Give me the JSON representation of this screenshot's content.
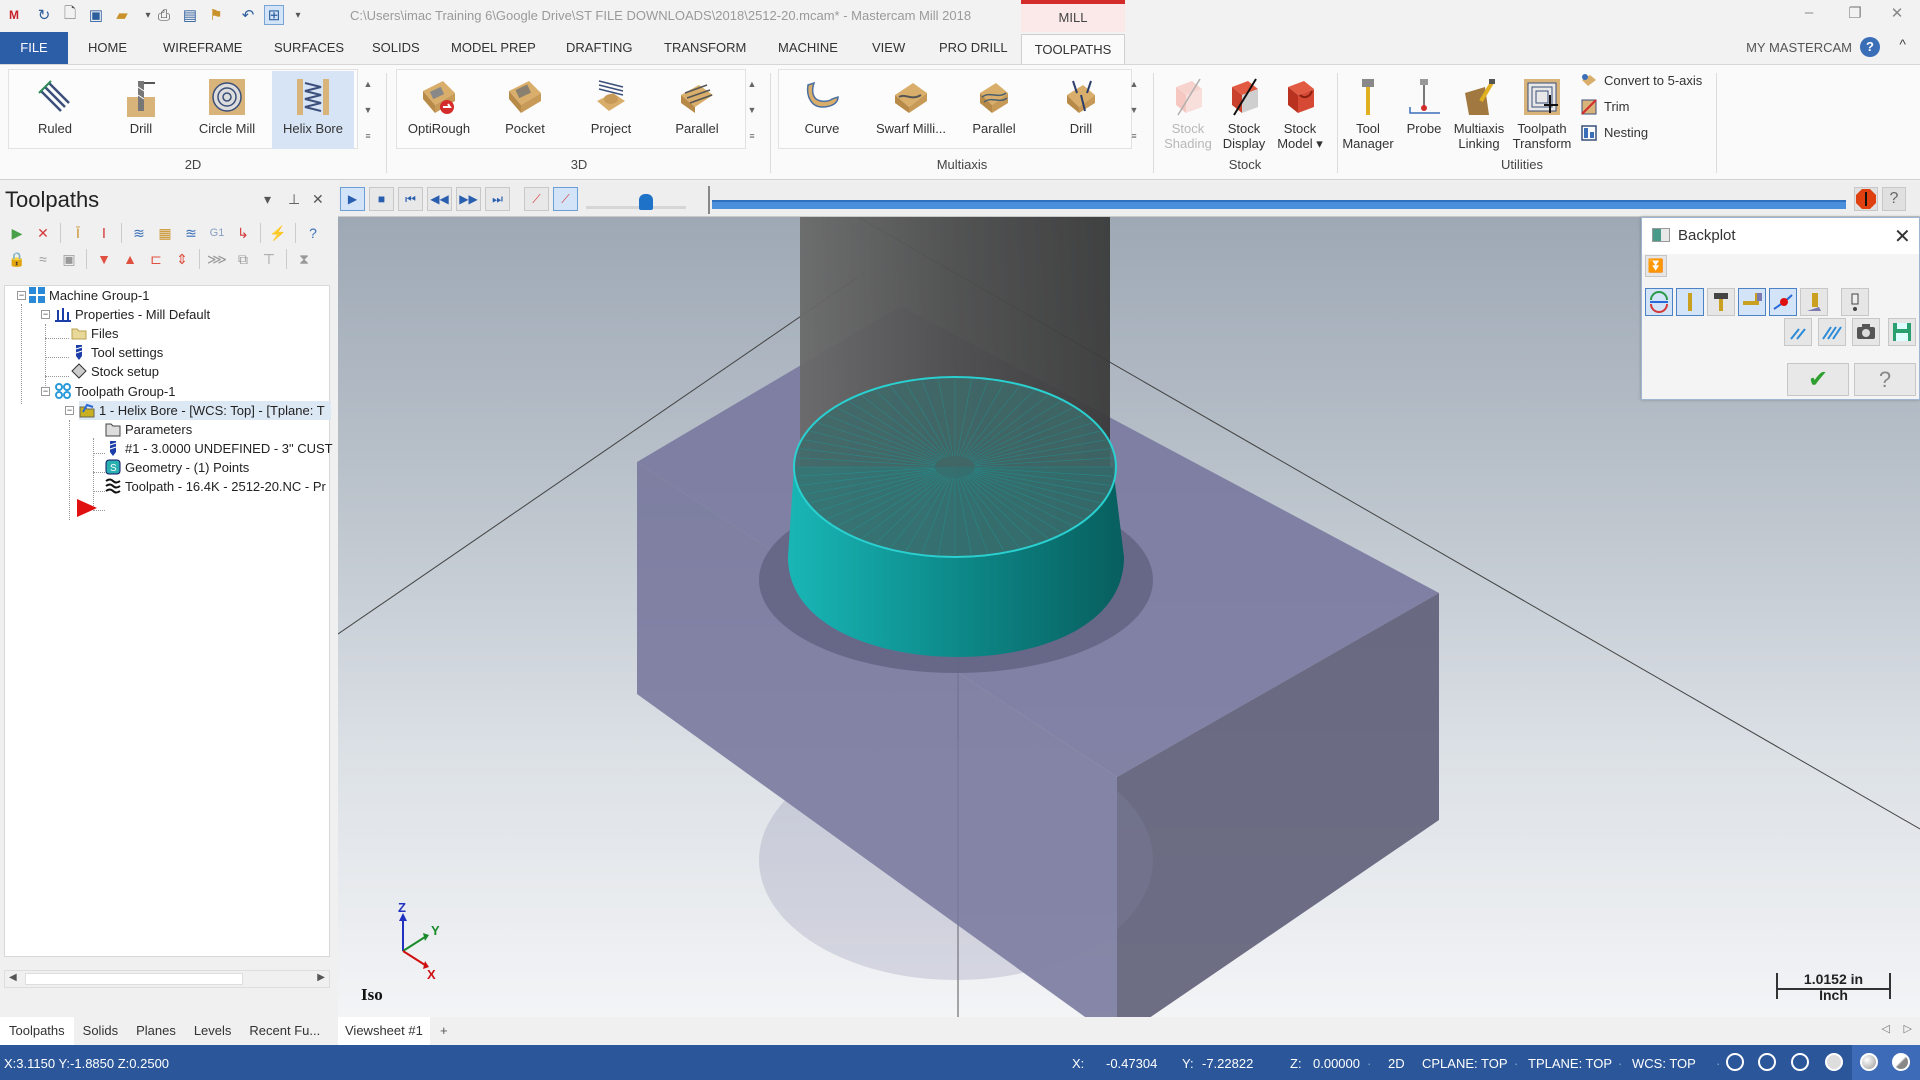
{
  "titlebar": {
    "title": "C:\\Users\\imac Training 6\\Google Drive\\ST FILE DOWNLOADS\\2018\\2512-20.mcam* - Mastercam Mill 2018",
    "context_tab": "MILL",
    "quick_access": [
      "app-logo-icon",
      "redo-icon",
      "new-file-icon",
      "save-icon",
      "open-icon",
      "print-icon",
      "save-as-icon",
      "flag-icon",
      "undo-icon",
      "view-toggle-icon",
      "customize-dropdown-icon"
    ],
    "window_controls": {
      "minimize": "–",
      "restore": "❐",
      "close": "✕"
    }
  },
  "tabs": [
    "FILE",
    "HOME",
    "WIREFRAME",
    "SURFACES",
    "SOLIDS",
    "MODEL PREP",
    "DRAFTING",
    "TRANSFORM",
    "MACHINE",
    "VIEW",
    "PRO DRILL",
    "TOOLPATHS"
  ],
  "active_tab": "TOOLPATHS",
  "account": {
    "label": "MY MASTERCAM",
    "help": "?",
    "collapse": "^"
  },
  "ribbon": {
    "groups": [
      {
        "name": "2D",
        "buttons": [
          "Ruled",
          "Drill",
          "Circle Mill",
          "Helix Bore"
        ],
        "selected": "Helix Bore"
      },
      {
        "name": "3D",
        "buttons": [
          "OptiRough",
          "Pocket",
          "Project",
          "Parallel"
        ]
      },
      {
        "name": "Multiaxis",
        "buttons": [
          "Curve",
          "Swarf Milli...",
          "Parallel",
          "Drill"
        ]
      },
      {
        "name": "Stock",
        "buttons": [
          {
            "line1": "Stock",
            "line2": "Shading",
            "disabled": true
          },
          {
            "line1": "Stock",
            "line2": "Display",
            "disabled": false
          },
          {
            "line1": "Stock",
            "line2": "Model ▾",
            "disabled": false
          }
        ]
      },
      {
        "name": "Utilities",
        "buttons": [
          {
            "line1": "Tool",
            "line2": "Manager"
          },
          {
            "line1": "Probe",
            "line2": ""
          },
          {
            "line1": "Multiaxis",
            "line2": "Linking"
          },
          {
            "line1": "Toolpath",
            "line2": "Transform"
          }
        ],
        "small_buttons": [
          "Convert to 5-axis",
          "Trim",
          "Nesting"
        ]
      }
    ]
  },
  "left_panel": {
    "title": "Toolpaths",
    "tree": [
      {
        "label": "Machine Group-1",
        "icon": "machine-group-icon"
      },
      {
        "label": "Properties - Mill Default",
        "icon": "properties-icon"
      },
      {
        "label": "Files",
        "icon": "folder-icon"
      },
      {
        "label": "Tool settings",
        "icon": "tool-icon"
      },
      {
        "label": "Stock setup",
        "icon": "stock-icon"
      },
      {
        "label": "Toolpath Group-1",
        "icon": "toolpath-group-icon"
      },
      {
        "label": "1 - Helix Bore - [WCS: Top] - [Tplane: T",
        "icon": "operation-folder-icon",
        "selected": true
      },
      {
        "label": "Parameters",
        "icon": "parameters-folder-icon"
      },
      {
        "label": "#1 - 3.0000 UNDEFINED - 3\" CUST",
        "icon": "tool-icon"
      },
      {
        "label": "Geometry - (1) Points",
        "icon": "geometry-icon"
      },
      {
        "label": "Toolpath - 16.4K - 2512-20.NC - Pr",
        "icon": "toolpath-icon"
      }
    ],
    "bottom_tabs": [
      "Toolpaths",
      "Solids",
      "Planes",
      "Levels",
      "Recent Fu..."
    ],
    "active_bottom_tab": "Toolpaths"
  },
  "backplot_bar": {
    "buttons": [
      "play",
      "stop",
      "step-back-start",
      "step-back",
      "step-forward",
      "step-forward-end",
      "show-toolpath",
      "show-tool"
    ],
    "speed": 0.6,
    "progress": 1.0
  },
  "viewport": {
    "view_name": "Iso",
    "axes": {
      "x": "X",
      "y": "Y",
      "z": "Z"
    },
    "scale_value": "1.0152 in",
    "scale_unit": "Inch",
    "colors": {
      "stock": "#7a7a9c",
      "tool_holder": "#4a4a4a",
      "cutter": "#0f8f8f",
      "background_top": "#9aa5b2"
    }
  },
  "backplot_dialog": {
    "title": "Backplot",
    "close": "✕",
    "ok": "✔",
    "help": "?"
  },
  "viewsheet_tabs": [
    "Viewsheet #1",
    "+"
  ],
  "status": {
    "cursor": "X:3.1150   Y:-1.8850   Z:0.2500",
    "x_label": "X:",
    "x_value": "-0.47304",
    "y_label": "Y:",
    "y_value": "-7.22822",
    "z_label": "Z:",
    "z_value": "0.00000",
    "mode": "2D",
    "cplane": "CPLANE: TOP",
    "tplane": "TPLANE: TOP",
    "wcs": "WCS: TOP"
  }
}
